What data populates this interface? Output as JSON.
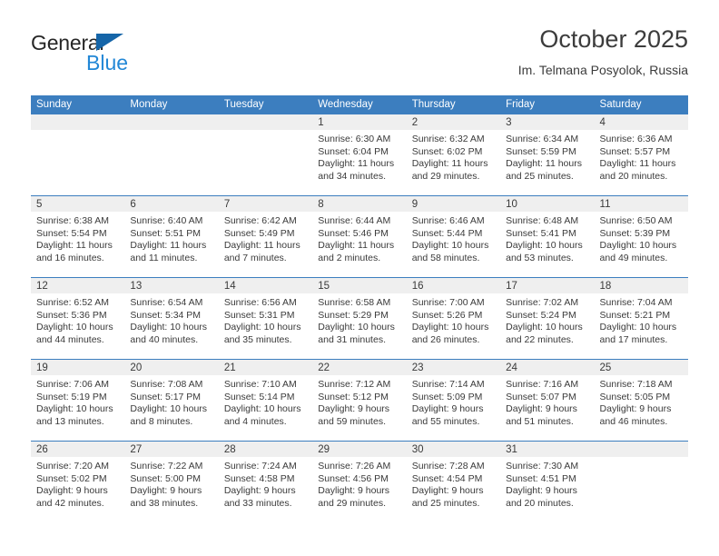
{
  "brand": {
    "line1": "General",
    "line2": "Blue",
    "triangle_color": "#1565a8",
    "line2_color": "#2287d6"
  },
  "header": {
    "title": "October 2025",
    "subtitle": "Im. Telmana Posyolok, Russia"
  },
  "theme": {
    "header_bar": "#3c7ebf",
    "cell_head": "#efefef",
    "text": "#3a3a3a"
  },
  "calendar": {
    "weekday_headers": [
      "Sunday",
      "Monday",
      "Tuesday",
      "Wednesday",
      "Thursday",
      "Friday",
      "Saturday"
    ],
    "weeks": [
      [
        {
          "day": "",
          "sunrise": "",
          "sunset": "",
          "daylight1": "",
          "daylight2": ""
        },
        {
          "day": "",
          "sunrise": "",
          "sunset": "",
          "daylight1": "",
          "daylight2": ""
        },
        {
          "day": "",
          "sunrise": "",
          "sunset": "",
          "daylight1": "",
          "daylight2": ""
        },
        {
          "day": "1",
          "sunrise": "Sunrise: 6:30 AM",
          "sunset": "Sunset: 6:04 PM",
          "daylight1": "Daylight: 11 hours",
          "daylight2": "and 34 minutes."
        },
        {
          "day": "2",
          "sunrise": "Sunrise: 6:32 AM",
          "sunset": "Sunset: 6:02 PM",
          "daylight1": "Daylight: 11 hours",
          "daylight2": "and 29 minutes."
        },
        {
          "day": "3",
          "sunrise": "Sunrise: 6:34 AM",
          "sunset": "Sunset: 5:59 PM",
          "daylight1": "Daylight: 11 hours",
          "daylight2": "and 25 minutes."
        },
        {
          "day": "4",
          "sunrise": "Sunrise: 6:36 AM",
          "sunset": "Sunset: 5:57 PM",
          "daylight1": "Daylight: 11 hours",
          "daylight2": "and 20 minutes."
        }
      ],
      [
        {
          "day": "5",
          "sunrise": "Sunrise: 6:38 AM",
          "sunset": "Sunset: 5:54 PM",
          "daylight1": "Daylight: 11 hours",
          "daylight2": "and 16 minutes."
        },
        {
          "day": "6",
          "sunrise": "Sunrise: 6:40 AM",
          "sunset": "Sunset: 5:51 PM",
          "daylight1": "Daylight: 11 hours",
          "daylight2": "and 11 minutes."
        },
        {
          "day": "7",
          "sunrise": "Sunrise: 6:42 AM",
          "sunset": "Sunset: 5:49 PM",
          "daylight1": "Daylight: 11 hours",
          "daylight2": "and 7 minutes."
        },
        {
          "day": "8",
          "sunrise": "Sunrise: 6:44 AM",
          "sunset": "Sunset: 5:46 PM",
          "daylight1": "Daylight: 11 hours",
          "daylight2": "and 2 minutes."
        },
        {
          "day": "9",
          "sunrise": "Sunrise: 6:46 AM",
          "sunset": "Sunset: 5:44 PM",
          "daylight1": "Daylight: 10 hours",
          "daylight2": "and 58 minutes."
        },
        {
          "day": "10",
          "sunrise": "Sunrise: 6:48 AM",
          "sunset": "Sunset: 5:41 PM",
          "daylight1": "Daylight: 10 hours",
          "daylight2": "and 53 minutes."
        },
        {
          "day": "11",
          "sunrise": "Sunrise: 6:50 AM",
          "sunset": "Sunset: 5:39 PM",
          "daylight1": "Daylight: 10 hours",
          "daylight2": "and 49 minutes."
        }
      ],
      [
        {
          "day": "12",
          "sunrise": "Sunrise: 6:52 AM",
          "sunset": "Sunset: 5:36 PM",
          "daylight1": "Daylight: 10 hours",
          "daylight2": "and 44 minutes."
        },
        {
          "day": "13",
          "sunrise": "Sunrise: 6:54 AM",
          "sunset": "Sunset: 5:34 PM",
          "daylight1": "Daylight: 10 hours",
          "daylight2": "and 40 minutes."
        },
        {
          "day": "14",
          "sunrise": "Sunrise: 6:56 AM",
          "sunset": "Sunset: 5:31 PM",
          "daylight1": "Daylight: 10 hours",
          "daylight2": "and 35 minutes."
        },
        {
          "day": "15",
          "sunrise": "Sunrise: 6:58 AM",
          "sunset": "Sunset: 5:29 PM",
          "daylight1": "Daylight: 10 hours",
          "daylight2": "and 31 minutes."
        },
        {
          "day": "16",
          "sunrise": "Sunrise: 7:00 AM",
          "sunset": "Sunset: 5:26 PM",
          "daylight1": "Daylight: 10 hours",
          "daylight2": "and 26 minutes."
        },
        {
          "day": "17",
          "sunrise": "Sunrise: 7:02 AM",
          "sunset": "Sunset: 5:24 PM",
          "daylight1": "Daylight: 10 hours",
          "daylight2": "and 22 minutes."
        },
        {
          "day": "18",
          "sunrise": "Sunrise: 7:04 AM",
          "sunset": "Sunset: 5:21 PM",
          "daylight1": "Daylight: 10 hours",
          "daylight2": "and 17 minutes."
        }
      ],
      [
        {
          "day": "19",
          "sunrise": "Sunrise: 7:06 AM",
          "sunset": "Sunset: 5:19 PM",
          "daylight1": "Daylight: 10 hours",
          "daylight2": "and 13 minutes."
        },
        {
          "day": "20",
          "sunrise": "Sunrise: 7:08 AM",
          "sunset": "Sunset: 5:17 PM",
          "daylight1": "Daylight: 10 hours",
          "daylight2": "and 8 minutes."
        },
        {
          "day": "21",
          "sunrise": "Sunrise: 7:10 AM",
          "sunset": "Sunset: 5:14 PM",
          "daylight1": "Daylight: 10 hours",
          "daylight2": "and 4 minutes."
        },
        {
          "day": "22",
          "sunrise": "Sunrise: 7:12 AM",
          "sunset": "Sunset: 5:12 PM",
          "daylight1": "Daylight: 9 hours",
          "daylight2": "and 59 minutes."
        },
        {
          "day": "23",
          "sunrise": "Sunrise: 7:14 AM",
          "sunset": "Sunset: 5:09 PM",
          "daylight1": "Daylight: 9 hours",
          "daylight2": "and 55 minutes."
        },
        {
          "day": "24",
          "sunrise": "Sunrise: 7:16 AM",
          "sunset": "Sunset: 5:07 PM",
          "daylight1": "Daylight: 9 hours",
          "daylight2": "and 51 minutes."
        },
        {
          "day": "25",
          "sunrise": "Sunrise: 7:18 AM",
          "sunset": "Sunset: 5:05 PM",
          "daylight1": "Daylight: 9 hours",
          "daylight2": "and 46 minutes."
        }
      ],
      [
        {
          "day": "26",
          "sunrise": "Sunrise: 7:20 AM",
          "sunset": "Sunset: 5:02 PM",
          "daylight1": "Daylight: 9 hours",
          "daylight2": "and 42 minutes."
        },
        {
          "day": "27",
          "sunrise": "Sunrise: 7:22 AM",
          "sunset": "Sunset: 5:00 PM",
          "daylight1": "Daylight: 9 hours",
          "daylight2": "and 38 minutes."
        },
        {
          "day": "28",
          "sunrise": "Sunrise: 7:24 AM",
          "sunset": "Sunset: 4:58 PM",
          "daylight1": "Daylight: 9 hours",
          "daylight2": "and 33 minutes."
        },
        {
          "day": "29",
          "sunrise": "Sunrise: 7:26 AM",
          "sunset": "Sunset: 4:56 PM",
          "daylight1": "Daylight: 9 hours",
          "daylight2": "and 29 minutes."
        },
        {
          "day": "30",
          "sunrise": "Sunrise: 7:28 AM",
          "sunset": "Sunset: 4:54 PM",
          "daylight1": "Daylight: 9 hours",
          "daylight2": "and 25 minutes."
        },
        {
          "day": "31",
          "sunrise": "Sunrise: 7:30 AM",
          "sunset": "Sunset: 4:51 PM",
          "daylight1": "Daylight: 9 hours",
          "daylight2": "and 20 minutes."
        },
        {
          "day": "",
          "sunrise": "",
          "sunset": "",
          "daylight1": "",
          "daylight2": ""
        }
      ]
    ]
  }
}
